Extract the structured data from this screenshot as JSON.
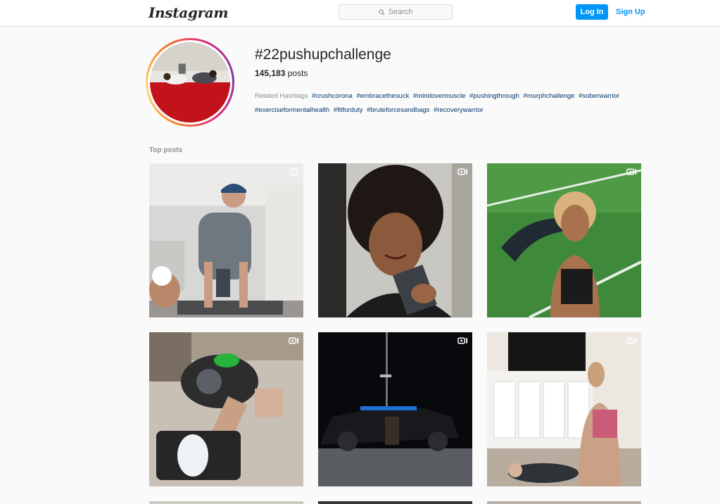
{
  "header": {
    "logo": "Instagram",
    "search_placeholder": "Search",
    "login_label": "Log In",
    "signup_label": "Sign Up"
  },
  "profile": {
    "hashtag": "#22pushupchallenge",
    "post_count": "145,183",
    "post_count_suffix": " posts",
    "related_label": "Related Hashtags",
    "related_tags": [
      "#crushcorona",
      "#embracethesuck",
      "#mindovermuscle",
      "#pushingthrough",
      "#murphchallenge",
      "#soberwarrior",
      "#exerciseformentalhealth",
      "#fitforduty",
      "#bruteforcesandbags",
      "#recoverywarrior"
    ]
  },
  "top_posts_label": "Top posts",
  "posts": [
    {
      "type": "igtv",
      "icon": "igtv-icon"
    },
    {
      "type": "video",
      "icon": "video-icon"
    },
    {
      "type": "video",
      "icon": "video-icon"
    },
    {
      "type": "video",
      "icon": "video-icon"
    },
    {
      "type": "video",
      "icon": "video-icon"
    },
    {
      "type": "video",
      "icon": "video-icon"
    }
  ],
  "colors": {
    "accent": "#0095f6",
    "tag_link": "#00376b",
    "muted": "#8e8e8e"
  }
}
